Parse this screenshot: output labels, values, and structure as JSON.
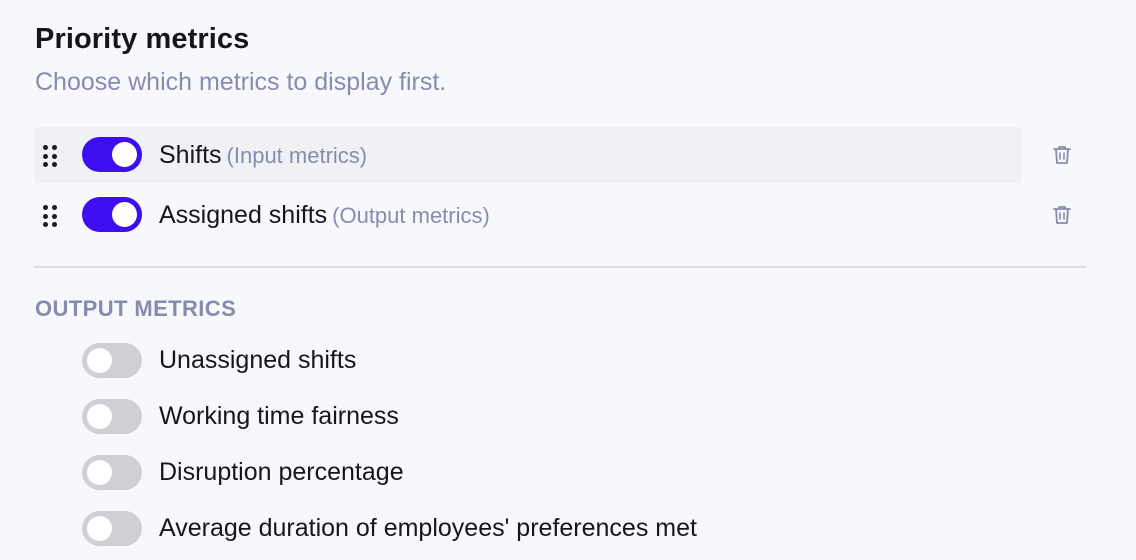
{
  "priority": {
    "title": "Priority metrics",
    "subtitle": "Choose which metrics to display first.",
    "items": [
      {
        "name": "Shifts",
        "category": "(Input metrics)",
        "enabled": true
      },
      {
        "name": "Assigned shifts",
        "category": "(Output metrics)",
        "enabled": true
      }
    ]
  },
  "output_metrics": {
    "heading": "OUTPUT METRICS",
    "items": [
      {
        "name": "Unassigned shifts",
        "enabled": false
      },
      {
        "name": "Working time fairness",
        "enabled": false
      },
      {
        "name": "Disruption percentage",
        "enabled": false
      },
      {
        "name": "Average duration of employees' preferences met",
        "enabled": false
      }
    ]
  },
  "colors": {
    "toggle_on": "#3d0ff0",
    "toggle_off": "#cfd0d6",
    "muted_text": "#8b8aae"
  },
  "icons": {
    "drag": "drag-handle-icon",
    "delete": "trash-icon"
  }
}
